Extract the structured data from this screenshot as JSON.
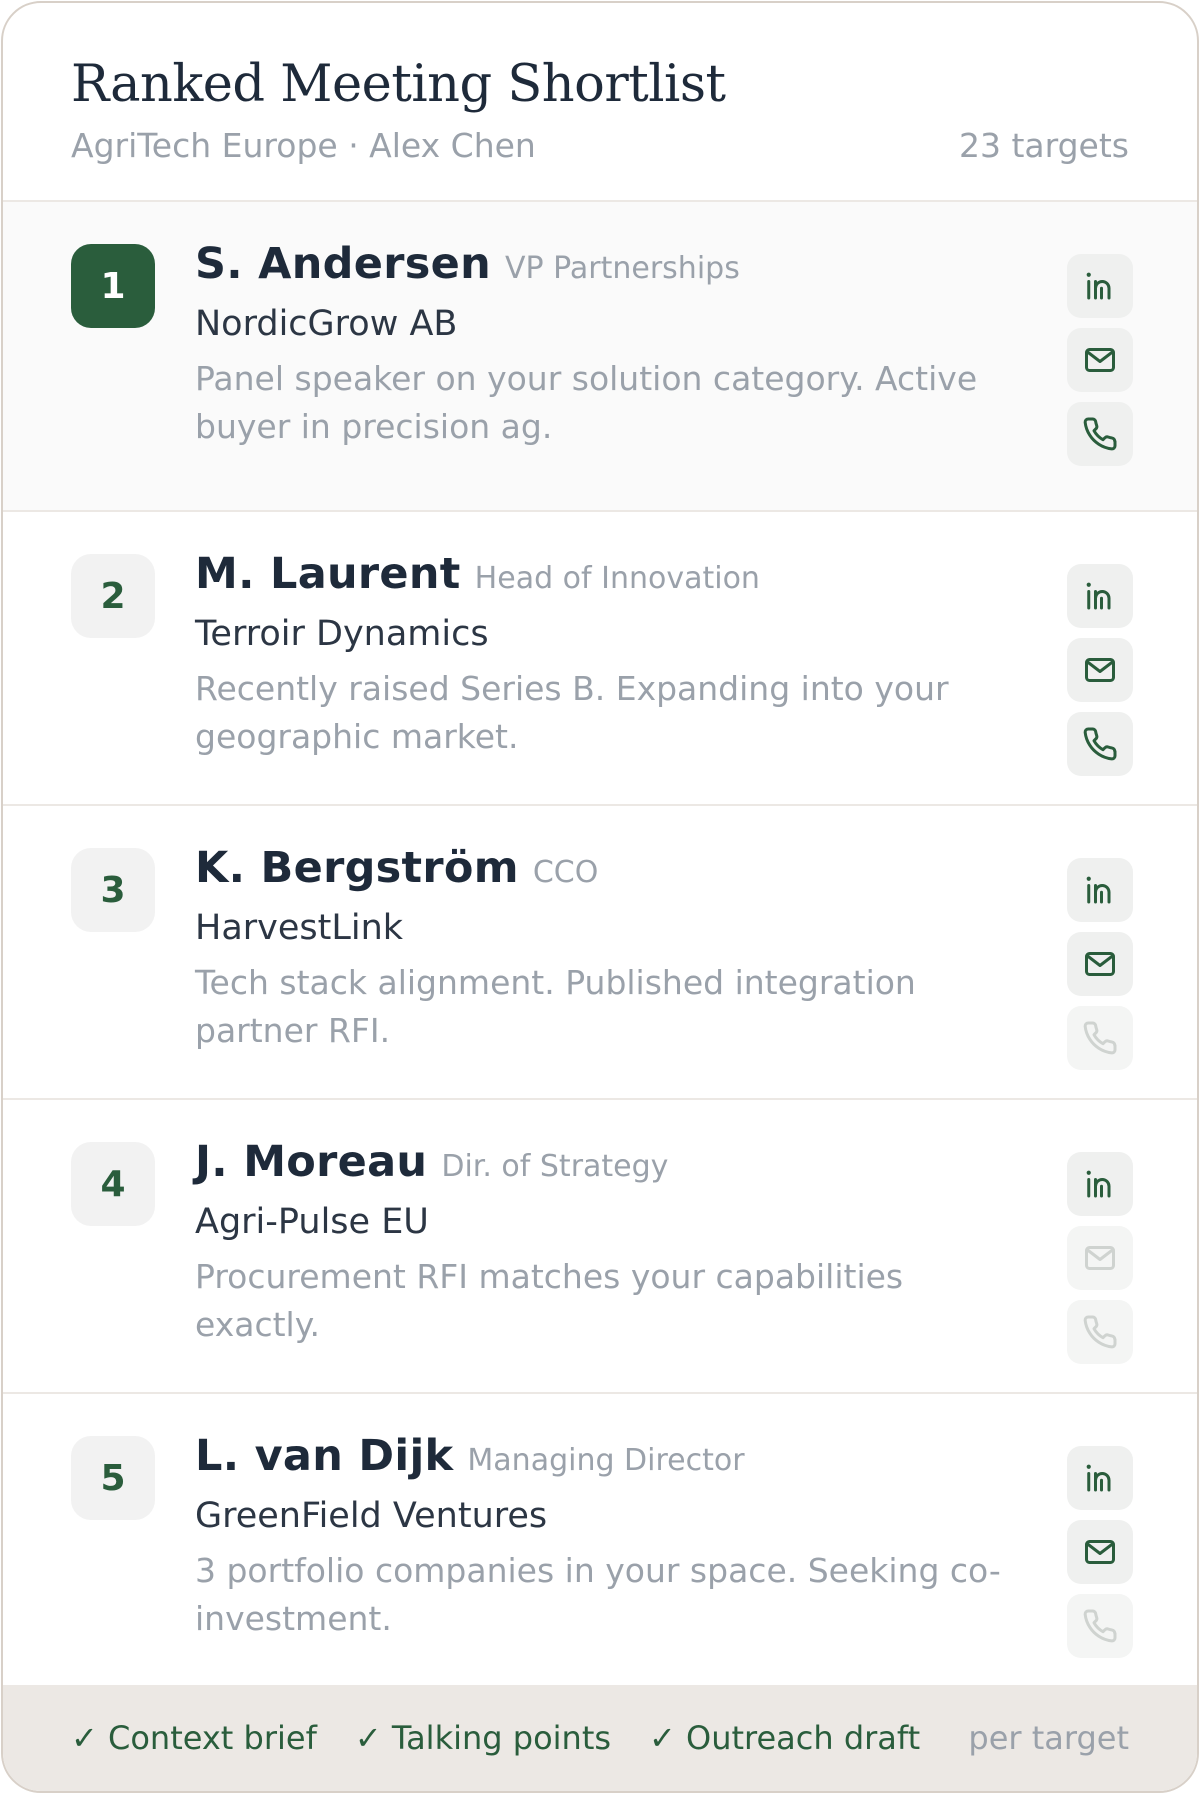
{
  "header": {
    "title": "Ranked Meeting Shortlist",
    "subtitle": "AgriTech Europe · Alex Chen",
    "count": "23 targets"
  },
  "colors": {
    "accent": "#2a5d3c",
    "muted": "#9aa1aa",
    "ink": "#1e2a3a"
  },
  "targets": [
    {
      "rank": "1",
      "name": "S. Andersen",
      "role": "VP Partnerships",
      "company": "NordicGrow AB",
      "note": "Panel speaker on your solution category. Active buyer in precision ag.",
      "linkedin": true,
      "email": true,
      "phone": true,
      "highlighted": true
    },
    {
      "rank": "2",
      "name": "M. Laurent",
      "role": "Head of Innovation",
      "company": "Terroir Dynamics",
      "note": "Recently raised Series B. Expanding into your geographic market.",
      "linkedin": true,
      "email": true,
      "phone": true,
      "highlighted": false
    },
    {
      "rank": "3",
      "name": "K. Bergström",
      "role": "CCO",
      "company": "HarvestLink",
      "note": "Tech stack alignment. Published integration partner RFI.",
      "linkedin": true,
      "email": true,
      "phone": false,
      "highlighted": false
    },
    {
      "rank": "4",
      "name": "J. Moreau",
      "role": "Dir. of Strategy",
      "company": "Agri-Pulse EU",
      "note": "Procurement RFI matches your capabilities exactly.",
      "linkedin": true,
      "email": false,
      "phone": false,
      "highlighted": false
    },
    {
      "rank": "5",
      "name": "L. van Dijk",
      "role": "Managing Director",
      "company": "GreenField Ventures",
      "note": "3 portfolio companies in your space. Seeking co-investment.",
      "linkedin": true,
      "email": true,
      "phone": false,
      "highlighted": false
    }
  ],
  "footer": {
    "items": [
      "✓ Context brief",
      "✓ Talking points",
      "✓ Outreach draft"
    ],
    "suffix": "per target"
  },
  "icons": {
    "linkedin": "linkedin-icon",
    "email": "mail-icon",
    "phone": "phone-icon"
  }
}
